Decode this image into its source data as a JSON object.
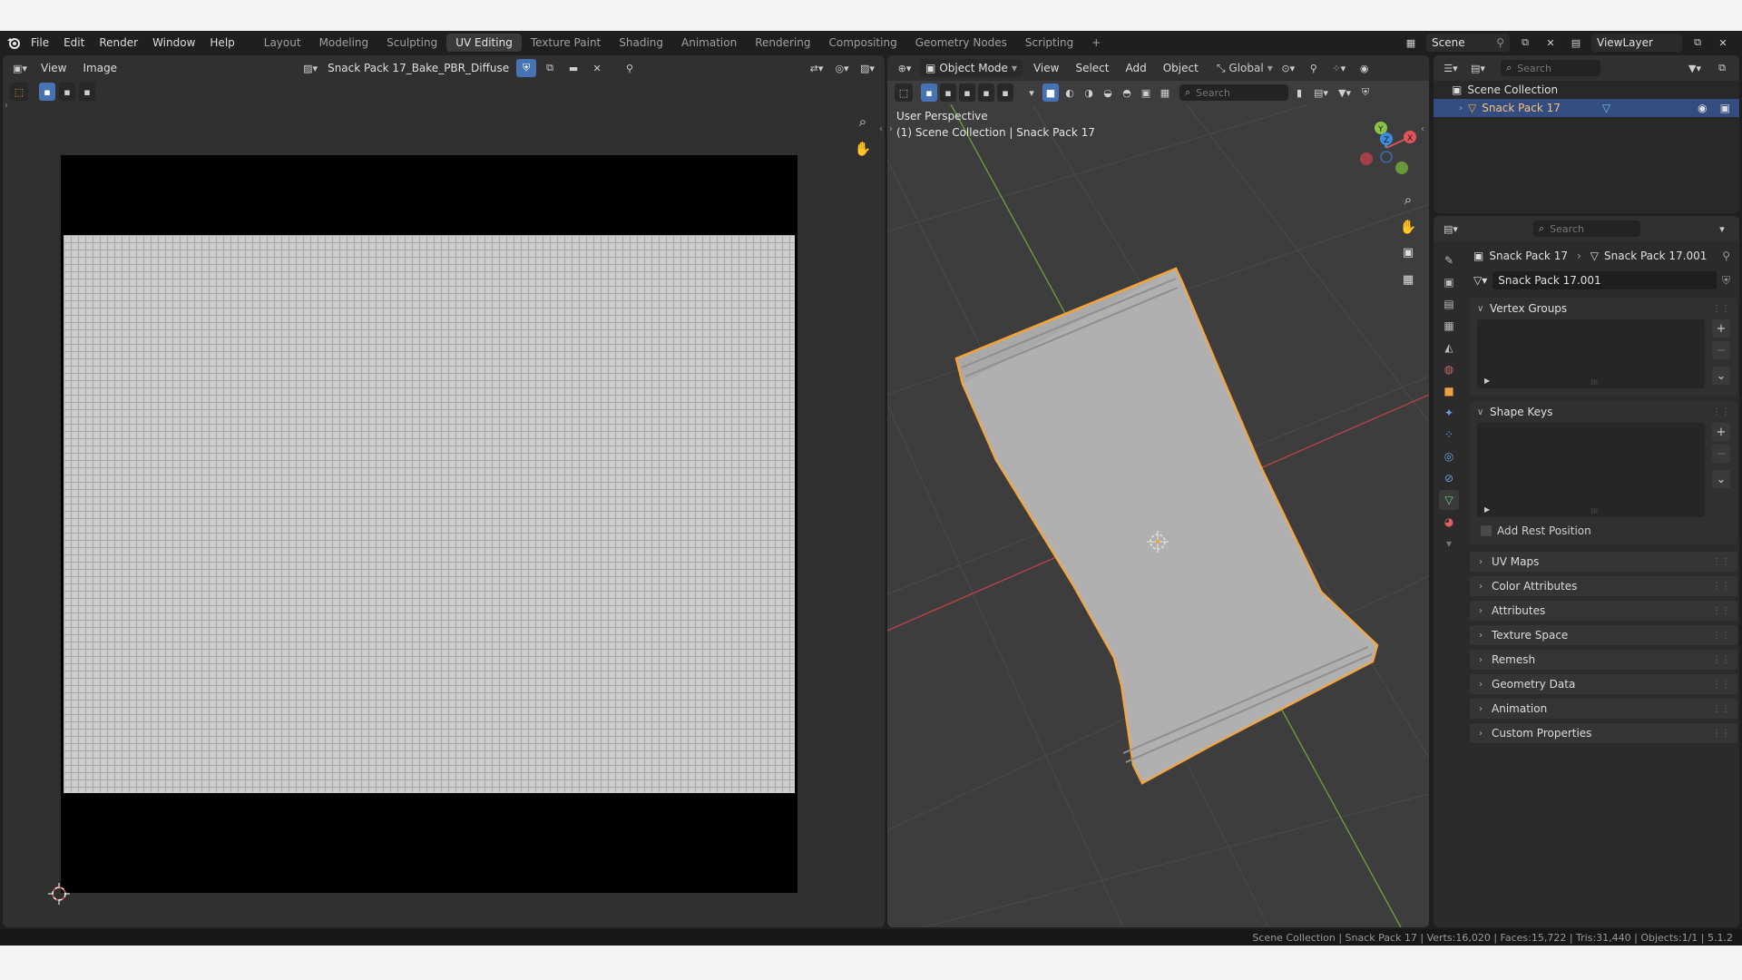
{
  "menu": {
    "file": "File",
    "edit": "Edit",
    "render": "Render",
    "window": "Window",
    "help": "Help"
  },
  "workspaces": [
    "Layout",
    "Modeling",
    "Sculpting",
    "UV Editing",
    "Texture Paint",
    "Shading",
    "Animation",
    "Rendering",
    "Compositing",
    "Geometry Nodes",
    "Scripting"
  ],
  "active_workspace": "UV Editing",
  "add_workspace": "+",
  "scene": {
    "name": "Scene",
    "view_layer": "ViewLayer"
  },
  "image_editor": {
    "menu_view": "View",
    "menu_image": "Image",
    "image_name": "Snack Pack 17_Bake_PBR_Diffuse"
  },
  "viewport": {
    "mode": "Object Mode",
    "menu_view": "View",
    "menu_select": "Select",
    "menu_add": "Add",
    "menu_object": "Object",
    "orientation": "Global",
    "search_placeholder": "Search",
    "perspective_label": "User Perspective",
    "context_label": "(1) Scene Collection | Snack Pack 17",
    "axis_x": "X",
    "axis_y": "Y",
    "axis_z": "Z"
  },
  "outliner": {
    "search_placeholder": "Search",
    "collection": "Scene Collection",
    "object": "Snack Pack 17"
  },
  "properties": {
    "search_placeholder": "Search",
    "breadcrumb_object": "Snack Pack 17",
    "breadcrumb_mesh": "Snack Pack 17.001",
    "mesh_name": "Snack Pack 17.001",
    "vertex_groups": "Vertex Groups",
    "shape_keys": "Shape Keys",
    "add_rest_position": "Add Rest Position",
    "panels": [
      "UV Maps",
      "Color Attributes",
      "Attributes",
      "Texture Space",
      "Remesh",
      "Geometry Data",
      "Animation",
      "Custom Properties"
    ]
  },
  "status": {
    "text": "Scene Collection | Snack Pack 17 | Verts:16,020 | Faces:15,722 | Tris:31,440 | Objects:1/1 | 5.1.2"
  },
  "colors": {
    "accent": "#4772b3",
    "selection": "#f7a235",
    "x_axis": "#e0535b",
    "y_axis": "#8bc34a",
    "z_axis": "#3b8ce0"
  }
}
